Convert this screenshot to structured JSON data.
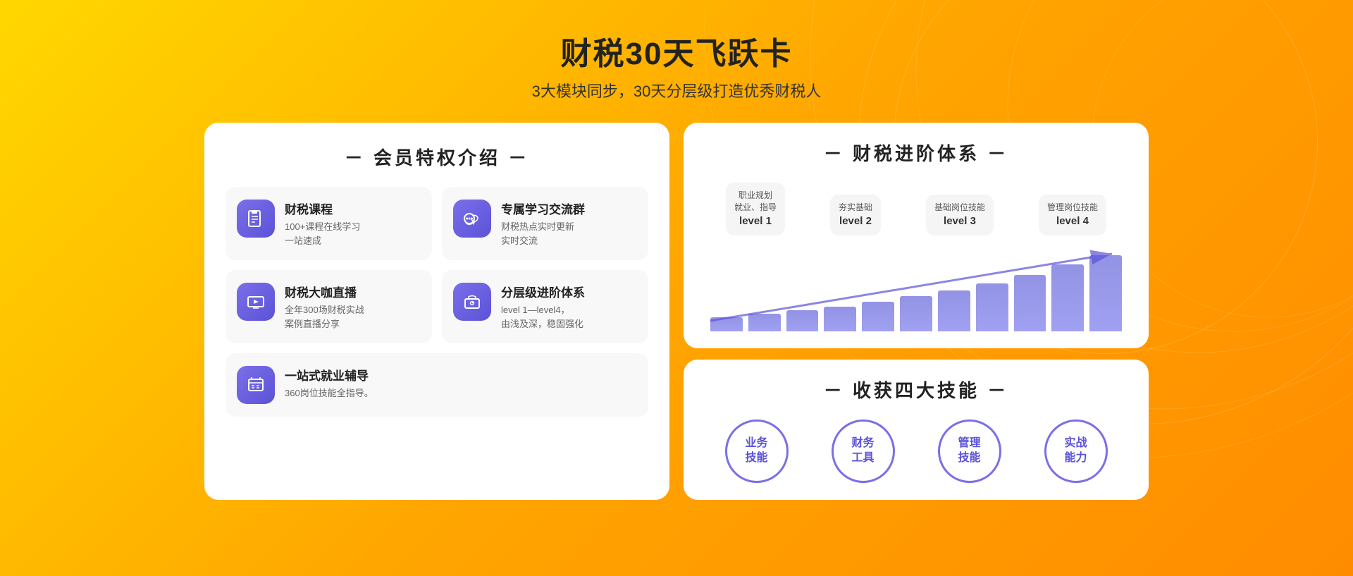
{
  "page": {
    "background_gradient": "linear-gradient(135deg, #FFD700, #FFA500, #FF8C00)"
  },
  "header": {
    "main_title": "财税30天飞跃卡",
    "sub_title": "3大模块同步，30天分层级打造优秀财税人"
  },
  "left_panel": {
    "title": "－ 会员特权介绍 －",
    "features": [
      {
        "name": "财税课程",
        "desc": "100+课程在线学习\n一站速成",
        "icon": "📋"
      },
      {
        "name": "专属学习交流群",
        "desc": "财税热点实时更新\n实时交流",
        "icon": "💬"
      },
      {
        "name": "财税大咖直播",
        "desc": "全年300场财税实战\n案例直播分享",
        "icon": "📺"
      },
      {
        "name": "分层级进阶体系",
        "desc": "level 1—level4，\n由浅及深，稳固强化",
        "icon": "💼"
      }
    ],
    "single_feature": {
      "name": "一站式就业辅导",
      "desc": "360岗位技能全指导。",
      "icon": "📝"
    }
  },
  "right_panel_top": {
    "title": "－ 财税进阶体系 －",
    "levels": [
      {
        "label": "职业规划\n就业、指导",
        "level": "level 1"
      },
      {
        "label": "夯实基础",
        "level": "level 2"
      },
      {
        "label": "基础岗位技能",
        "level": "level 3"
      },
      {
        "label": "管理岗位技能",
        "level": "level 4"
      }
    ],
    "bars": [
      20,
      25,
      30,
      35,
      42,
      50,
      58,
      68,
      80,
      95,
      108
    ]
  },
  "right_panel_bottom": {
    "title": "－ 收获四大技能 －",
    "skills": [
      "业务\n技能",
      "财务\n工具",
      "管理\n技能",
      "实战\n能力"
    ]
  }
}
